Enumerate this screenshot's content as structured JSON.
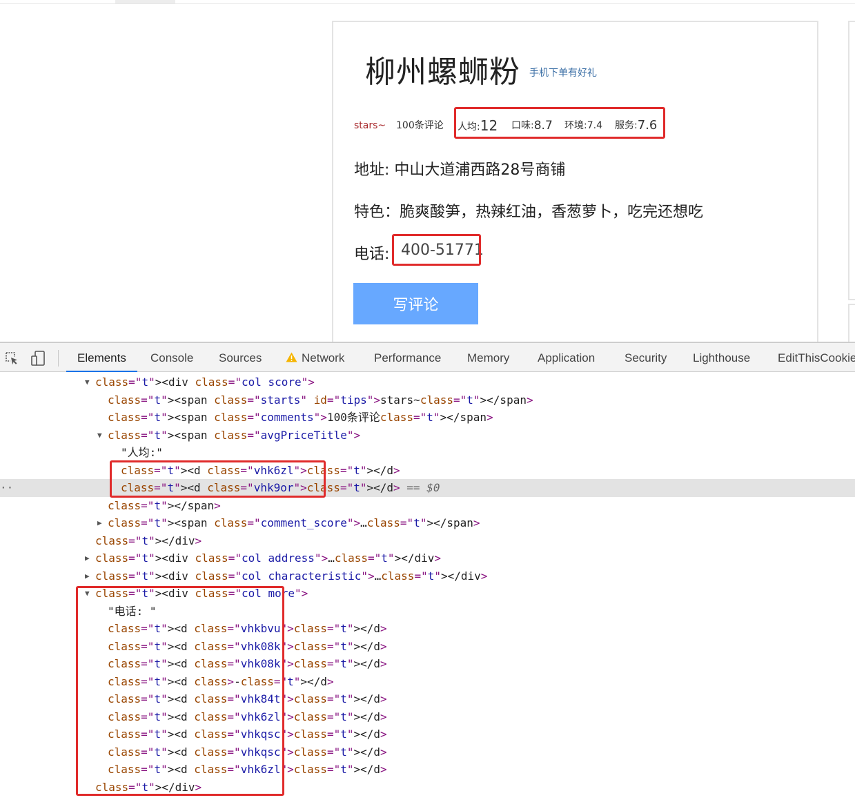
{
  "page": {
    "shop_name": "柳州螺蛳粉",
    "promo_link": "手机下单有好礼",
    "stars_text": "stars~",
    "comments_text": "100条评论",
    "avg_label": "人均:",
    "avg_value": "12",
    "taste_label": "口味:",
    "taste_value": "8.7",
    "env_label": "环境:",
    "env_value": "7.4",
    "service_label": "服务:",
    "service_value": "7.6",
    "address": "地址: 中山大道浦西路28号商铺",
    "feature": "特色：脆爽酸笋，热辣红油，香葱萝卜，吃完还想吃",
    "phone_label": "电话:",
    "phone_number": "400-51771",
    "review_button": "写评论"
  },
  "devtools": {
    "tabs": [
      "Elements",
      "Console",
      "Sources",
      "Network",
      "Performance",
      "Memory",
      "Application",
      "Security",
      "Lighthouse",
      "EditThisCookie"
    ],
    "active_tab": "Elements",
    "icons": [
      "inspect-element-icon",
      "device-toolbar-icon",
      "warning-icon"
    ],
    "highlight_color": "#e02b2b",
    "dom_lines": [
      "▼<div class=\"col score\">",
      "<span class=\"starts\" id=\"tips\">stars~</span>",
      "<span class=\"comments\">100条评论</span>",
      "▼<span class=\"avgPriceTitle\">",
      "\"人均:\"",
      "<d class=\"vhk6zl\"></d>",
      "<d class=\"vhk9or\"></d> == $0",
      "</span>",
      "▶<span class=\"comment_score\">…</span>",
      "</div>",
      "▶<div class=\"col address\">…</div>",
      "▶<div class=\"col characteristic\">…</div>",
      "▼<div class=\"col more\">",
      "\"电话: \"",
      "<d class=\"vhkbvu\"></d>",
      "<d class=\"vhk08k\"></d>",
      "<d class=\"vhk08k\"></d>",
      "<d class>-</d>",
      "<d class=\"vhk84t\"></d>",
      "<d class=\"vhk6zl\"></d>",
      "<d class=\"vhkqsc\"></d>",
      "<d class=\"vhkqsc\"></d>",
      "<d class=\"vhk6zl\"></d>",
      "</div>"
    ],
    "selected_marker": "== $0"
  }
}
